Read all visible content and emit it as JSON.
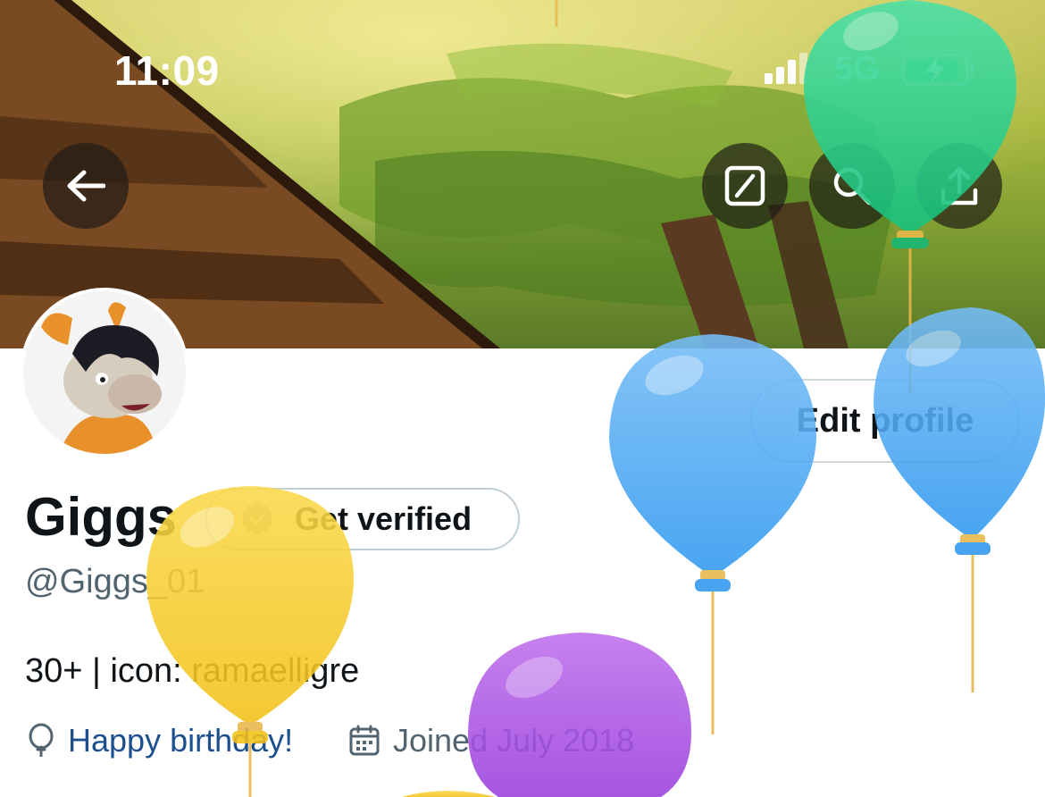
{
  "status_bar": {
    "time": "11:09",
    "network": "5G",
    "icons": [
      "signal-icon",
      "battery-charging-icon"
    ]
  },
  "header": {
    "buttons": [
      "back-arrow-icon",
      "edit-square-icon",
      "search-icon",
      "share-icon"
    ]
  },
  "profile": {
    "edit_label": "Edit profile",
    "name": "Giggs",
    "verify_label": "Get verified",
    "handle": "@Giggs_01",
    "bio": "30+ | icon: ramaelligre",
    "birthday": "Happy birthday!",
    "joined": "Joined July 2018"
  },
  "colors": {
    "accent_link": "#1d4f8f",
    "text_primary": "#0f1419",
    "text_secondary": "#536471",
    "balloon_green": "#2ecf91",
    "balloon_blue": "#4aa8f2",
    "balloon_yellow": "#f7cf2e",
    "balloon_purple": "#a651e0"
  }
}
